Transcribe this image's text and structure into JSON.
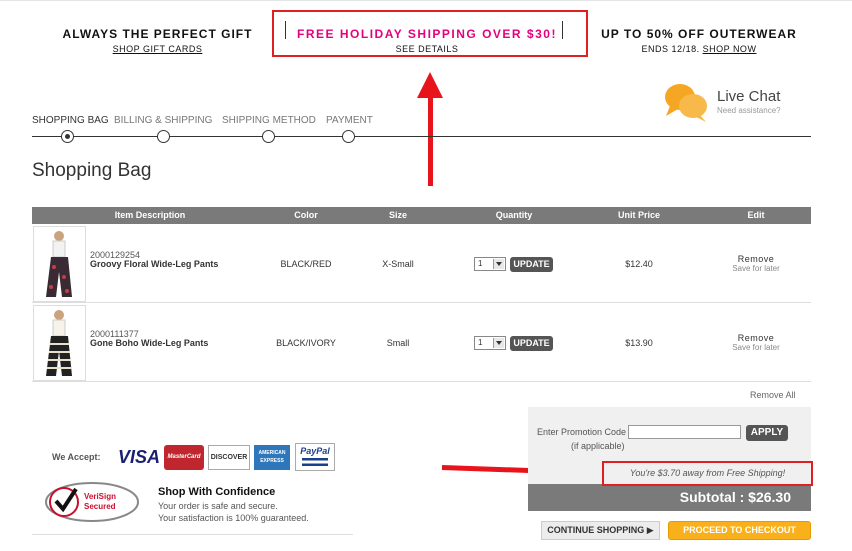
{
  "promo_bar": {
    "left_title": "ALWAYS THE PERFECT GIFT",
    "left_link": "SHOP GIFT CARDS",
    "center_title": "FREE HOLIDAY SHIPPING OVER $30!",
    "center_link": "SEE DETAILS",
    "right_title": "UP TO 50% OFF OUTERWEAR",
    "right_prefix": "ENDS 12/18.",
    "right_link": "SHOP NOW"
  },
  "checkout_steps": [
    {
      "label": "SHOPPING BAG",
      "active": true
    },
    {
      "label": "BILLING & SHIPPING",
      "active": false
    },
    {
      "label": "SHIPPING METHOD",
      "active": false
    },
    {
      "label": "PAYMENT",
      "active": false
    }
  ],
  "live_chat": {
    "title": "Live Chat",
    "subtitle": "Need assistance?",
    "icon": "chat-bubbles-icon"
  },
  "page_title": "Shopping Bag",
  "table": {
    "headers": [
      "Item Description",
      "Color",
      "Size",
      "Quantity",
      "Unit Price",
      "Edit"
    ],
    "rows": [
      {
        "sku": "2000129254",
        "name": "Groovy Floral Wide-Leg Pants",
        "color": "BLACK/RED",
        "size": "X-Small",
        "quantity": "1",
        "update_label": "UPDATE",
        "unit_price": "$12.40",
        "remove_label": "Remove",
        "save_label": "Save for later"
      },
      {
        "sku": "2000111377",
        "name": "Gone Boho Wide-Leg Pants",
        "color": "BLACK/IVORY",
        "size": "Small",
        "quantity": "1",
        "update_label": "UPDATE",
        "unit_price": "$13.90",
        "remove_label": "Remove",
        "save_label": "Save for later"
      }
    ],
    "remove_all": "Remove All"
  },
  "promo_code": {
    "label": "Enter Promotion Code",
    "sublabel": "(if applicable)",
    "value": "",
    "apply_label": "APPLY"
  },
  "free_shipping_message": "You're $3.70 away from Free Shipping!",
  "subtotal": "Subtotal : $26.30",
  "buttons": {
    "continue": "CONTINUE SHOPPING ▶",
    "checkout": "PROCEED TO CHECKOUT"
  },
  "accept": {
    "label": "We Accept:",
    "cards": [
      "VISA",
      "MasterCard",
      "DISCOVER",
      "AMERICAN EXPRESS",
      "PayPal"
    ]
  },
  "trust": {
    "badge": "VeriSign Secured",
    "badge_line1": "VeriSign",
    "badge_line2": "Secured",
    "title": "Shop With Confidence",
    "line1": "Your order is safe and secure.",
    "line2": "Your satisfaction is 100% guaranteed."
  },
  "colors": {
    "highlight_red": "#e02020",
    "arrow_red": "#e8141b",
    "promo_pink": "#e6007e",
    "checkout_orange": "#f9b01a",
    "header_gray": "#7a7a7a"
  }
}
